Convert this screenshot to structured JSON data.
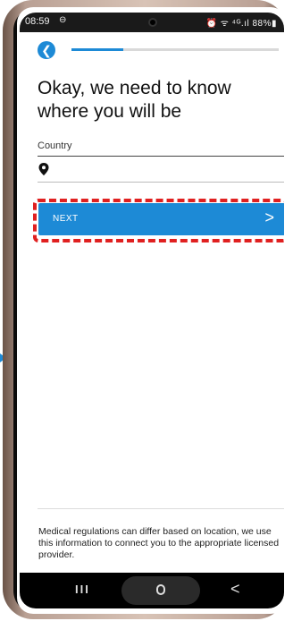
{
  "status_bar": {
    "time": "08:59",
    "dnd_glyph": "⊖",
    "right_icons": "⏰ ᯤ ⁴ᴳ.ıl 88%▮"
  },
  "header": {
    "back_icon": "chevron-left-icon",
    "progress_fraction": 0.25,
    "accent": "#1d8ad6"
  },
  "main": {
    "title": "Okay, we need to know where you will be",
    "country_label": "Country",
    "country_value": "",
    "next_label": "NEXT",
    "next_chevron": ">"
  },
  "footer": {
    "text": "Medical regulations can differ based on location, we use this information to connect you to the appropriate licensed provider."
  },
  "navbar": {
    "recent": "III",
    "back": "<"
  },
  "colors": {
    "primary": "#1d8ad6",
    "highlight": "#e02020"
  }
}
